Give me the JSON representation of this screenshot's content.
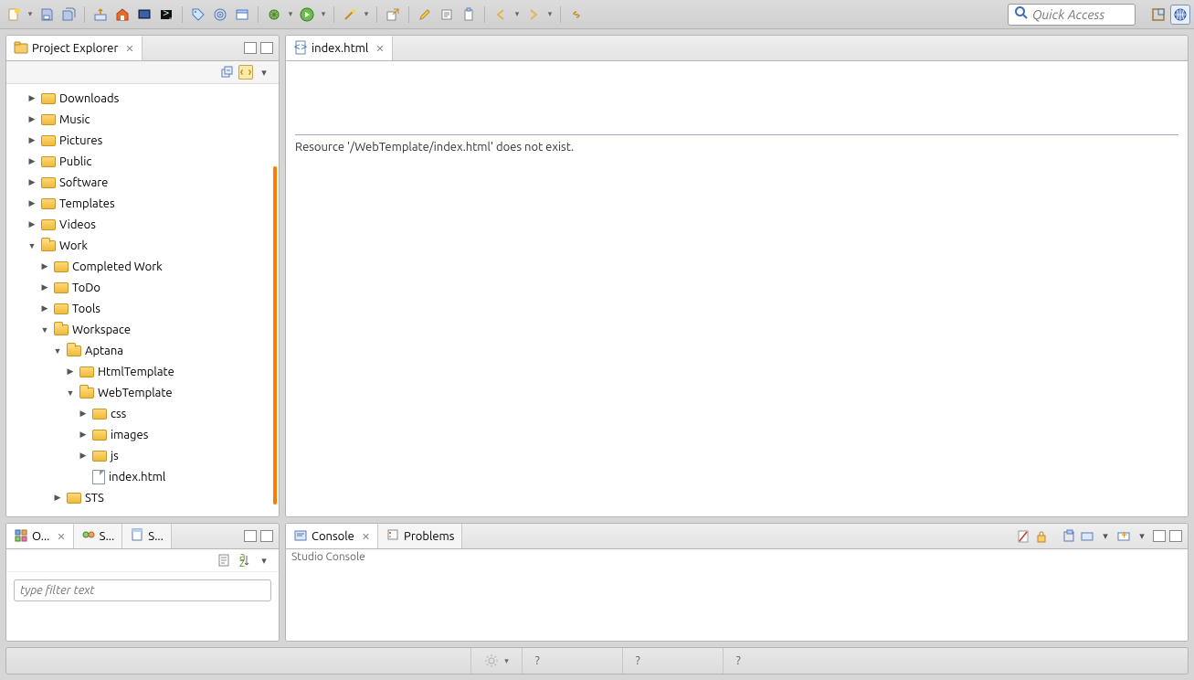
{
  "quick_access": {
    "placeholder": "Quick Access"
  },
  "explorer": {
    "tab_label": "Project Explorer",
    "tree": [
      {
        "label": "Downloads",
        "depth": 1,
        "expanded": false,
        "type": "folder"
      },
      {
        "label": "Music",
        "depth": 1,
        "expanded": false,
        "type": "folder"
      },
      {
        "label": "Pictures",
        "depth": 1,
        "expanded": false,
        "type": "folder"
      },
      {
        "label": "Public",
        "depth": 1,
        "expanded": false,
        "type": "folder"
      },
      {
        "label": "Software",
        "depth": 1,
        "expanded": false,
        "type": "folder"
      },
      {
        "label": "Templates",
        "depth": 1,
        "expanded": false,
        "type": "folder"
      },
      {
        "label": "Videos",
        "depth": 1,
        "expanded": false,
        "type": "folder"
      },
      {
        "label": "Work",
        "depth": 1,
        "expanded": true,
        "type": "folder"
      },
      {
        "label": "Completed Work",
        "depth": 2,
        "expanded": false,
        "type": "folder"
      },
      {
        "label": "ToDo",
        "depth": 2,
        "expanded": false,
        "type": "folder"
      },
      {
        "label": "Tools",
        "depth": 2,
        "expanded": false,
        "type": "folder"
      },
      {
        "label": "Workspace",
        "depth": 2,
        "expanded": true,
        "type": "folder"
      },
      {
        "label": "Aptana",
        "depth": 3,
        "expanded": true,
        "type": "folder"
      },
      {
        "label": "HtmlTemplate",
        "depth": 4,
        "expanded": false,
        "type": "folder"
      },
      {
        "label": "WebTemplate",
        "depth": 4,
        "expanded": true,
        "type": "folder"
      },
      {
        "label": "css",
        "depth": 5,
        "expanded": false,
        "type": "folder"
      },
      {
        "label": "images",
        "depth": 5,
        "expanded": false,
        "type": "folder"
      },
      {
        "label": "js",
        "depth": 5,
        "expanded": false,
        "type": "folder"
      },
      {
        "label": "index.html",
        "depth": 5,
        "expanded": null,
        "type": "file"
      },
      {
        "label": "STS",
        "depth": 3,
        "expanded": false,
        "type": "folder"
      }
    ]
  },
  "editor": {
    "tab_label": "index.html",
    "message": "Resource '/WebTemplate/index.html' does not exist."
  },
  "bottom_left": {
    "tabs": [
      "O...",
      "S...",
      "S..."
    ],
    "filter_placeholder": "type filter text"
  },
  "console": {
    "tabs": [
      "Console",
      "Problems"
    ],
    "body_title": "Studio Console"
  },
  "statusbar": {
    "cells": [
      "?",
      "?",
      "?"
    ]
  },
  "toolbar_icons": [
    "new",
    "dropdown",
    "save",
    "save-all",
    "sep",
    "publish",
    "home",
    "monitor",
    "terminal",
    "sep",
    "tag",
    "target",
    "window",
    "sep",
    "debug",
    "dropdown",
    "run",
    "dropdown",
    "sep",
    "wand",
    "dropdown",
    "sep",
    "external",
    "sep",
    "highlighter",
    "edit",
    "paste",
    "sep",
    "back",
    "dropdown",
    "forward",
    "dropdown",
    "sep",
    "link"
  ]
}
